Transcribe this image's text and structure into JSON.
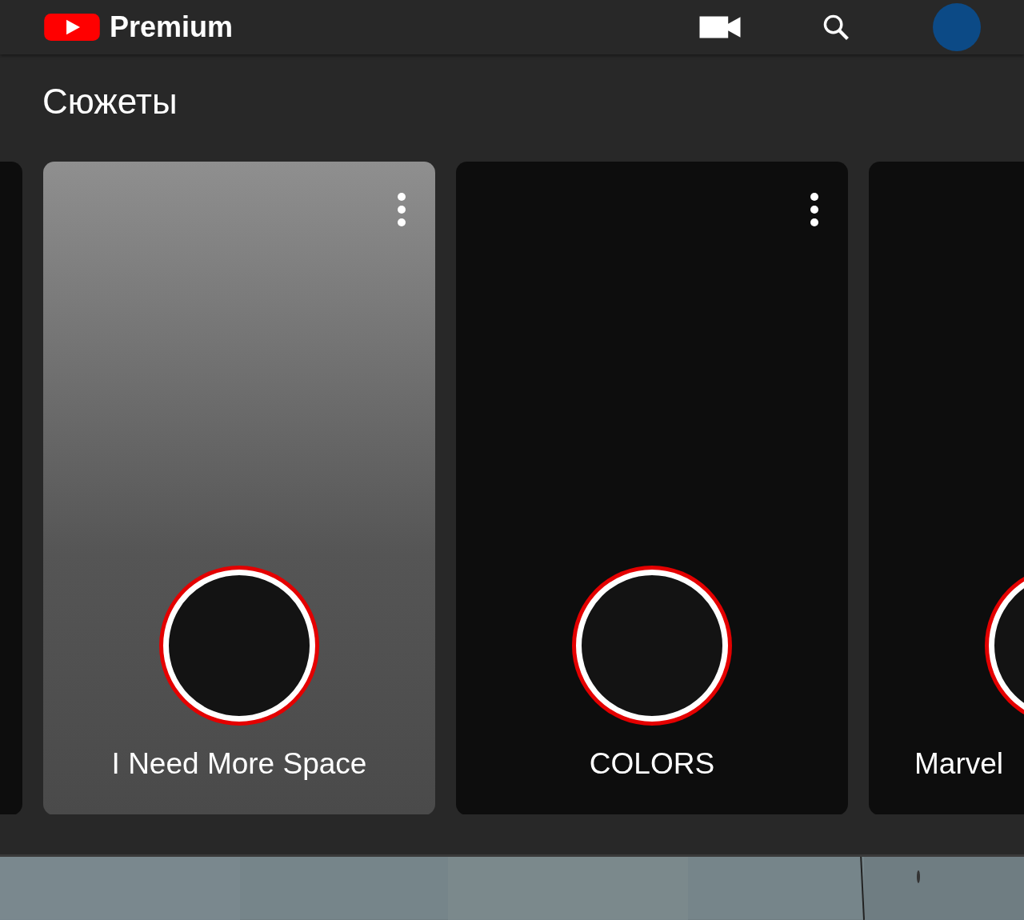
{
  "header": {
    "logo_text": "Premium"
  },
  "section": {
    "title": "Сюжеты"
  },
  "cards": [
    {
      "selected": false
    },
    {
      "title": "I Need More Space",
      "selected": true
    },
    {
      "title": "COLORS",
      "selected": false
    },
    {
      "title": "Marvel",
      "selected": false
    }
  ]
}
